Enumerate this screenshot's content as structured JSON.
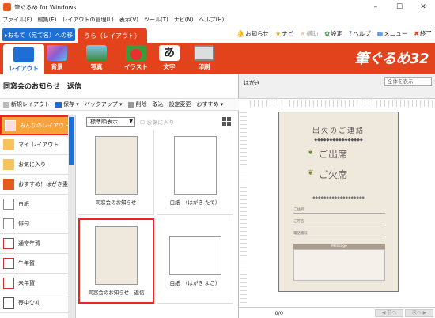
{
  "window": {
    "title": "筆ぐるめ for Windows"
  },
  "menu": [
    "ファイル(F)",
    "編集(E)",
    "レイアウトの管理(L)",
    "表示(V)",
    "ツール(T)",
    "ナビ(N)",
    "ヘルプ(H)"
  ],
  "tabs": {
    "front": "▸おもて（宛て名）への移",
    "back": "うら（レイアウト）"
  },
  "toplinks": [
    {
      "icon": "bell-icon",
      "glyph": "🔔",
      "label": "お知らせ"
    },
    {
      "icon": "star-icon",
      "glyph": "★",
      "label": "ナビ"
    },
    {
      "icon": "star-outline-icon",
      "glyph": "★",
      "label": "補助"
    },
    {
      "icon": "gear-icon",
      "glyph": "✿",
      "label": "設定"
    },
    {
      "icon": "help-icon",
      "glyph": "?",
      "label": "ヘルプ"
    },
    {
      "icon": "menu-icon",
      "glyph": "▦",
      "label": "メニュー"
    },
    {
      "icon": "close-icon",
      "glyph": "✖",
      "label": "終了"
    }
  ],
  "toolbar": {
    "buttons": [
      {
        "label": "レイアウト",
        "color": "#1d6fd6"
      },
      {
        "label": "背景",
        "color": "#e06fb3"
      },
      {
        "label": "写真",
        "color": "#5aa0d8"
      },
      {
        "label": "イラスト",
        "color": "#3c9a3c"
      },
      {
        "label": "文字",
        "color": "#222222"
      },
      {
        "label": "印刷",
        "color": "#888888"
      }
    ],
    "brand": "筆ぐるめ32"
  },
  "panel": {
    "title": "同窓会のお知らせ　返信",
    "actions": [
      "新規レイアウト",
      "保存 ▾",
      "バックアップ ▾",
      "削除",
      "取込",
      "設定変更",
      "おすすめ ▾"
    ]
  },
  "categories": [
    {
      "label": "みんなのレイアウト",
      "selected": true
    },
    {
      "label": "マイ レイアウト",
      "selected": false
    },
    {
      "label": "お気に入り",
      "selected": false
    },
    {
      "label": "おすすめ！はがき素材",
      "selected": false
    },
    {
      "label": "白紙",
      "selected": false
    },
    {
      "label": "俳句",
      "selected": false
    },
    {
      "label": "通常年賀",
      "selected": false
    },
    {
      "label": "午年賀",
      "selected": false
    },
    {
      "label": "未年賀",
      "selected": false
    },
    {
      "label": "喪中欠礼",
      "selected": false
    }
  ],
  "grid": {
    "sort": "標準順表示",
    "favorites_filter": "お気に入り",
    "items": [
      {
        "label": "同窓会のお知らせ",
        "selected": false
      },
      {
        "label": "白紙　（はがき たて）",
        "selected": false
      },
      {
        "label": "同窓会のお知らせ　返信",
        "selected": true
      },
      {
        "label": "白紙　（はがき よこ）",
        "selected": false
      }
    ]
  },
  "preview": {
    "paper": "はがき",
    "zoom": "全体を表示",
    "card": {
      "heading": "出欠のご連絡",
      "subline": "◆◆◆◆◆◆◆◆◆◆◆◆◆◆◆◆",
      "attend": "ご出席",
      "absent": "ご欠席",
      "note": "◆◆◆◆◆◆◆◆◆◆◆◆◆◆◆◆◆◆◆",
      "fields": [
        "ご住所",
        "ご芳名",
        "電話番号"
      ],
      "message_label": "Message"
    },
    "page": "0/0",
    "nav": [
      "◀ 前へ",
      "次へ ▶"
    ]
  }
}
